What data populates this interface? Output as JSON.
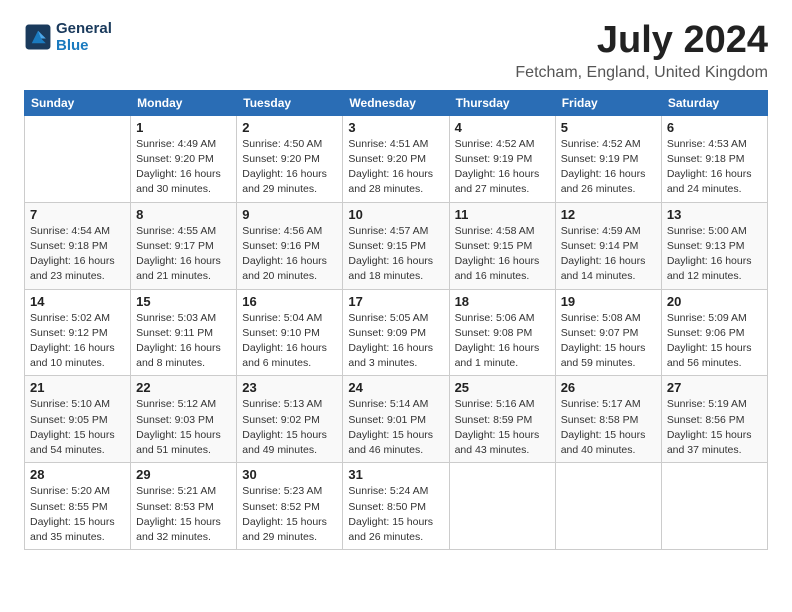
{
  "header": {
    "logo_line1": "General",
    "logo_line2": "Blue",
    "month": "July 2024",
    "location": "Fetcham, England, United Kingdom"
  },
  "columns": [
    "Sunday",
    "Monday",
    "Tuesday",
    "Wednesday",
    "Thursday",
    "Friday",
    "Saturday"
  ],
  "weeks": [
    [
      {
        "day": "",
        "info": ""
      },
      {
        "day": "1",
        "info": "Sunrise: 4:49 AM\nSunset: 9:20 PM\nDaylight: 16 hours\nand 30 minutes."
      },
      {
        "day": "2",
        "info": "Sunrise: 4:50 AM\nSunset: 9:20 PM\nDaylight: 16 hours\nand 29 minutes."
      },
      {
        "day": "3",
        "info": "Sunrise: 4:51 AM\nSunset: 9:20 PM\nDaylight: 16 hours\nand 28 minutes."
      },
      {
        "day": "4",
        "info": "Sunrise: 4:52 AM\nSunset: 9:19 PM\nDaylight: 16 hours\nand 27 minutes."
      },
      {
        "day": "5",
        "info": "Sunrise: 4:52 AM\nSunset: 9:19 PM\nDaylight: 16 hours\nand 26 minutes."
      },
      {
        "day": "6",
        "info": "Sunrise: 4:53 AM\nSunset: 9:18 PM\nDaylight: 16 hours\nand 24 minutes."
      }
    ],
    [
      {
        "day": "7",
        "info": "Sunrise: 4:54 AM\nSunset: 9:18 PM\nDaylight: 16 hours\nand 23 minutes."
      },
      {
        "day": "8",
        "info": "Sunrise: 4:55 AM\nSunset: 9:17 PM\nDaylight: 16 hours\nand 21 minutes."
      },
      {
        "day": "9",
        "info": "Sunrise: 4:56 AM\nSunset: 9:16 PM\nDaylight: 16 hours\nand 20 minutes."
      },
      {
        "day": "10",
        "info": "Sunrise: 4:57 AM\nSunset: 9:15 PM\nDaylight: 16 hours\nand 18 minutes."
      },
      {
        "day": "11",
        "info": "Sunrise: 4:58 AM\nSunset: 9:15 PM\nDaylight: 16 hours\nand 16 minutes."
      },
      {
        "day": "12",
        "info": "Sunrise: 4:59 AM\nSunset: 9:14 PM\nDaylight: 16 hours\nand 14 minutes."
      },
      {
        "day": "13",
        "info": "Sunrise: 5:00 AM\nSunset: 9:13 PM\nDaylight: 16 hours\nand 12 minutes."
      }
    ],
    [
      {
        "day": "14",
        "info": "Sunrise: 5:02 AM\nSunset: 9:12 PM\nDaylight: 16 hours\nand 10 minutes."
      },
      {
        "day": "15",
        "info": "Sunrise: 5:03 AM\nSunset: 9:11 PM\nDaylight: 16 hours\nand 8 minutes."
      },
      {
        "day": "16",
        "info": "Sunrise: 5:04 AM\nSunset: 9:10 PM\nDaylight: 16 hours\nand 6 minutes."
      },
      {
        "day": "17",
        "info": "Sunrise: 5:05 AM\nSunset: 9:09 PM\nDaylight: 16 hours\nand 3 minutes."
      },
      {
        "day": "18",
        "info": "Sunrise: 5:06 AM\nSunset: 9:08 PM\nDaylight: 16 hours\nand 1 minute."
      },
      {
        "day": "19",
        "info": "Sunrise: 5:08 AM\nSunset: 9:07 PM\nDaylight: 15 hours\nand 59 minutes."
      },
      {
        "day": "20",
        "info": "Sunrise: 5:09 AM\nSunset: 9:06 PM\nDaylight: 15 hours\nand 56 minutes."
      }
    ],
    [
      {
        "day": "21",
        "info": "Sunrise: 5:10 AM\nSunset: 9:05 PM\nDaylight: 15 hours\nand 54 minutes."
      },
      {
        "day": "22",
        "info": "Sunrise: 5:12 AM\nSunset: 9:03 PM\nDaylight: 15 hours\nand 51 minutes."
      },
      {
        "day": "23",
        "info": "Sunrise: 5:13 AM\nSunset: 9:02 PM\nDaylight: 15 hours\nand 49 minutes."
      },
      {
        "day": "24",
        "info": "Sunrise: 5:14 AM\nSunset: 9:01 PM\nDaylight: 15 hours\nand 46 minutes."
      },
      {
        "day": "25",
        "info": "Sunrise: 5:16 AM\nSunset: 8:59 PM\nDaylight: 15 hours\nand 43 minutes."
      },
      {
        "day": "26",
        "info": "Sunrise: 5:17 AM\nSunset: 8:58 PM\nDaylight: 15 hours\nand 40 minutes."
      },
      {
        "day": "27",
        "info": "Sunrise: 5:19 AM\nSunset: 8:56 PM\nDaylight: 15 hours\nand 37 minutes."
      }
    ],
    [
      {
        "day": "28",
        "info": "Sunrise: 5:20 AM\nSunset: 8:55 PM\nDaylight: 15 hours\nand 35 minutes."
      },
      {
        "day": "29",
        "info": "Sunrise: 5:21 AM\nSunset: 8:53 PM\nDaylight: 15 hours\nand 32 minutes."
      },
      {
        "day": "30",
        "info": "Sunrise: 5:23 AM\nSunset: 8:52 PM\nDaylight: 15 hours\nand 29 minutes."
      },
      {
        "day": "31",
        "info": "Sunrise: 5:24 AM\nSunset: 8:50 PM\nDaylight: 15 hours\nand 26 minutes."
      },
      {
        "day": "",
        "info": ""
      },
      {
        "day": "",
        "info": ""
      },
      {
        "day": "",
        "info": ""
      }
    ]
  ]
}
